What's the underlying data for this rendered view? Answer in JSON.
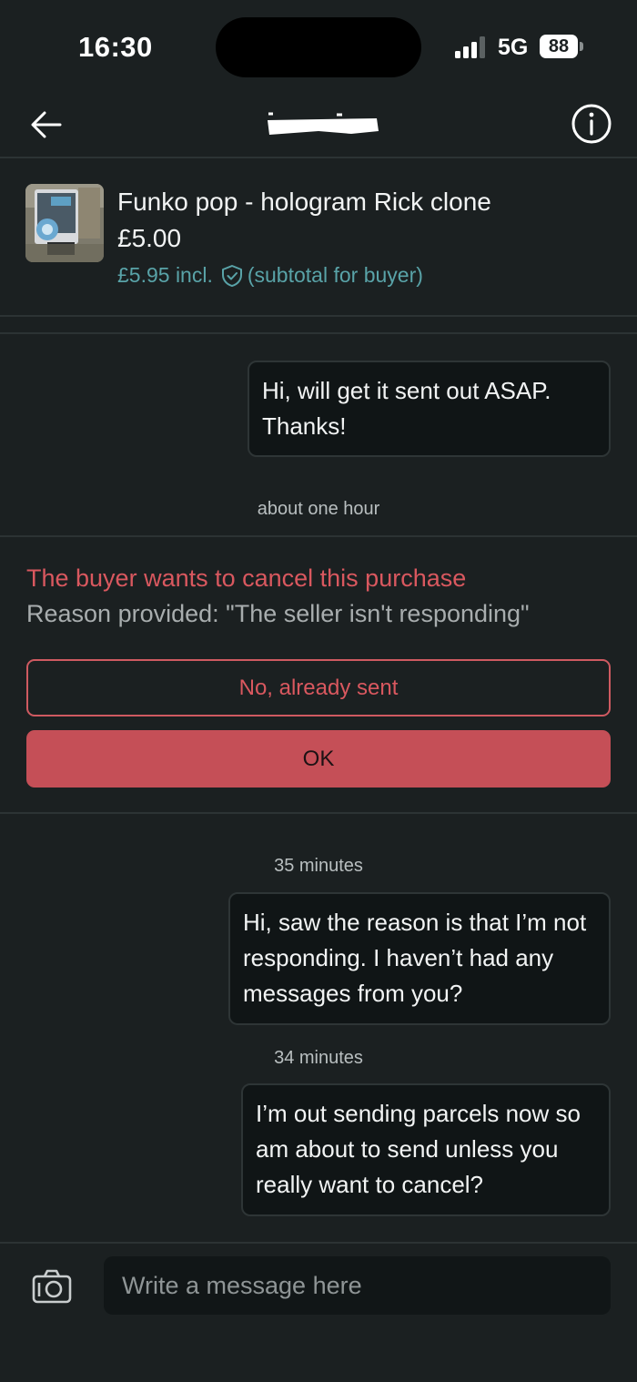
{
  "status_bar": {
    "time": "16:30",
    "network": "5G",
    "battery": "88"
  },
  "nav": {
    "title": ""
  },
  "product": {
    "title": "Funko pop - hologram Rick clone",
    "price": "£5.00",
    "price_incl": "£5.95 incl.",
    "subtotal_note": "(subtotal for buyer)"
  },
  "messages": [
    {
      "text": "Hi, will get it sent out ASAP. Thanks!",
      "timestamp": "about one hour"
    },
    {
      "text": "Hi, saw the reason is that I’m not responding. I haven’t had any messages from you?",
      "timestamp": "35 minutes"
    },
    {
      "text": "I’m out sending parcels now so am about to send unless you really want to cancel?",
      "timestamp": "34 minutes"
    }
  ],
  "cancel_request": {
    "title": "The buyer wants to cancel this purchase",
    "reason": "Reason provided: \"The seller isn't responding\"",
    "decline_label": "No, already sent",
    "accept_label": "OK"
  },
  "composer": {
    "placeholder": "Write a message here"
  },
  "colors": {
    "background": "#1b2021",
    "accent_teal": "#59a3a8",
    "alert_red": "#d9585f",
    "button_red": "#c54f57"
  },
  "icons": [
    "back-arrow-icon",
    "info-icon",
    "shield-check-icon",
    "camera-icon",
    "signal-icon"
  ]
}
